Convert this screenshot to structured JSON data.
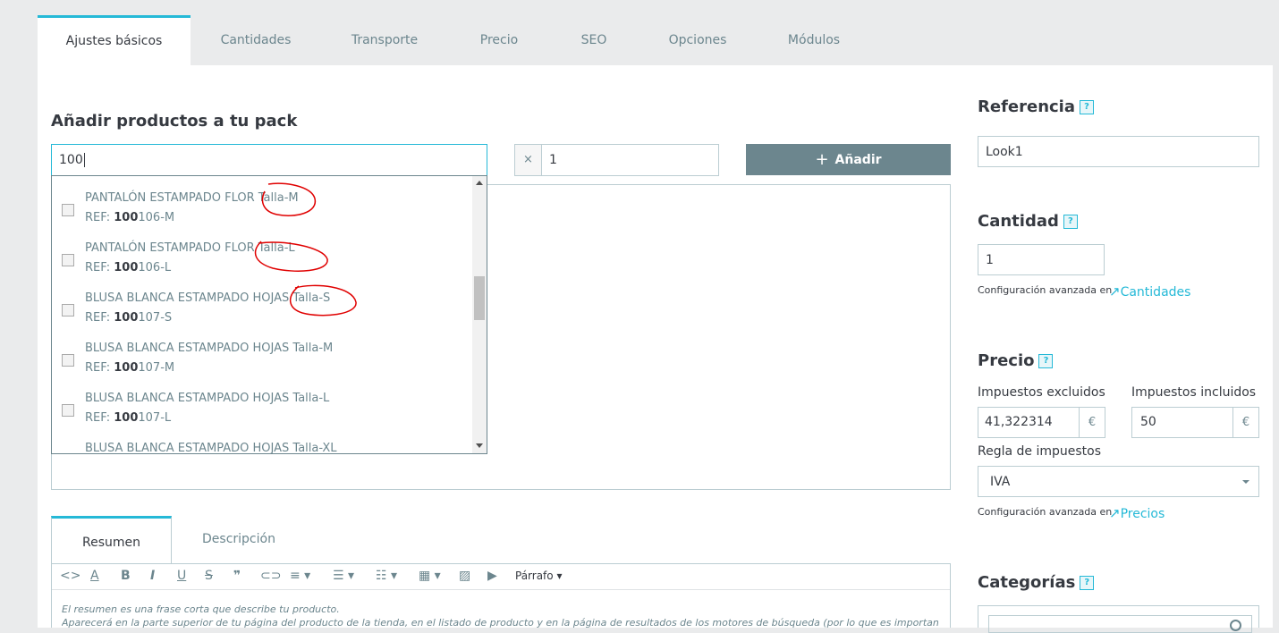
{
  "tabs": [
    {
      "label": "Ajustes básicos",
      "active": true
    },
    {
      "label": "Cantidades"
    },
    {
      "label": "Transporte"
    },
    {
      "label": "Precio"
    },
    {
      "label": "SEO"
    },
    {
      "label": "Opciones"
    },
    {
      "label": "Módulos"
    }
  ],
  "pack": {
    "title": "Añadir productos a tu pack",
    "search_value": "100",
    "qty_prefix": "×",
    "qty_value": "1",
    "add_label": "Añadir"
  },
  "dropdown": [
    {
      "name": "PANTALÓN ESTAMPADO FLOR Talla-M",
      "ref_label": "REF:",
      "ref_bold": "100",
      "ref_rest": "106-M"
    },
    {
      "name": "PANTALÓN ESTAMPADO FLOR Talla-L",
      "ref_label": "REF:",
      "ref_bold": "100",
      "ref_rest": "106-L"
    },
    {
      "name": "BLUSA BLANCA ESTAMPADO HOJAS Talla-S",
      "ref_label": "REF:",
      "ref_bold": "100",
      "ref_rest": "107-S"
    },
    {
      "name": "BLUSA BLANCA ESTAMPADO HOJAS Talla-M",
      "ref_label": "REF:",
      "ref_bold": "100",
      "ref_rest": "107-M"
    },
    {
      "name": "BLUSA BLANCA ESTAMPADO HOJAS Talla-L",
      "ref_label": "REF:",
      "ref_bold": "100",
      "ref_rest": "107-L"
    },
    {
      "name": "BLUSA BLANCA ESTAMPADO HOJAS Talla-XL"
    }
  ],
  "description": {
    "tabs": [
      {
        "label": "Resumen",
        "active": true
      },
      {
        "label": "Descripción"
      }
    ],
    "paragraph_label": "Párrafo",
    "line1": "El resumen es una frase corta que describe tu producto.",
    "line2": "Aparecerá en la parte superior de tu página del producto de la tienda, en el listado de producto y en la página de resultados de los motores de búsqueda (por lo que es importante para"
  },
  "sidebar": {
    "referencia": {
      "title": "Referencia",
      "help": "?",
      "value": "Look1"
    },
    "cantidad": {
      "title": "Cantidad",
      "help": "?",
      "value": "1",
      "advanced_text": "Configuración avanzada en",
      "advanced_link": "Cantidades"
    },
    "precio": {
      "title": "Precio",
      "help": "?",
      "excl_label": "Impuestos excluidos",
      "excl_value": "41,322314",
      "incl_label": "Impuestos incluidos",
      "incl_value": "50",
      "currency": "€",
      "tax_rule_label": "Regla de impuestos",
      "tax_rule_value": "IVA",
      "advanced_text": "Configuración avanzada en",
      "advanced_link": "Precios"
    },
    "categorias": {
      "title": "Categorías",
      "help": "?"
    }
  },
  "colors": {
    "accent": "#25b9d7",
    "add_button": "#6c868e",
    "annotation": "#e00000"
  }
}
